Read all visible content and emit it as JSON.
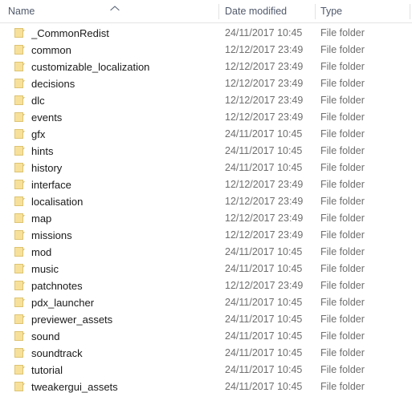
{
  "window": {
    "title": "File Explorer details list"
  },
  "header": {
    "columns": [
      {
        "id": "name",
        "label": "Name"
      },
      {
        "id": "date_modified",
        "label": "Date modified"
      },
      {
        "id": "type",
        "label": "Type"
      }
    ],
    "sort": {
      "column": "Name",
      "direction": "ascending",
      "icon": "chevron-up-icon"
    }
  },
  "list": {
    "icon": "folder-icon",
    "icon_color": "#f7e19a",
    "icon_border_color": "#ddc372",
    "rows": [
      {
        "name": "_CommonRedist",
        "date_modified": "24/11/2017 10:45",
        "type": "File folder"
      },
      {
        "name": "common",
        "date_modified": "12/12/2017 23:49",
        "type": "File folder"
      },
      {
        "name": "customizable_localization",
        "date_modified": "12/12/2017 23:49",
        "type": "File folder"
      },
      {
        "name": "decisions",
        "date_modified": "12/12/2017 23:49",
        "type": "File folder"
      },
      {
        "name": "dlc",
        "date_modified": "12/12/2017 23:49",
        "type": "File folder"
      },
      {
        "name": "events",
        "date_modified": "12/12/2017 23:49",
        "type": "File folder"
      },
      {
        "name": "gfx",
        "date_modified": "24/11/2017 10:45",
        "type": "File folder"
      },
      {
        "name": "hints",
        "date_modified": "24/11/2017 10:45",
        "type": "File folder"
      },
      {
        "name": "history",
        "date_modified": "24/11/2017 10:45",
        "type": "File folder"
      },
      {
        "name": "interface",
        "date_modified": "12/12/2017 23:49",
        "type": "File folder"
      },
      {
        "name": "localisation",
        "date_modified": "12/12/2017 23:49",
        "type": "File folder"
      },
      {
        "name": "map",
        "date_modified": "12/12/2017 23:49",
        "type": "File folder"
      },
      {
        "name": "missions",
        "date_modified": "12/12/2017 23:49",
        "type": "File folder"
      },
      {
        "name": "mod",
        "date_modified": "24/11/2017 10:45",
        "type": "File folder"
      },
      {
        "name": "music",
        "date_modified": "24/11/2017 10:45",
        "type": "File folder"
      },
      {
        "name": "patchnotes",
        "date_modified": "12/12/2017 23:49",
        "type": "File folder"
      },
      {
        "name": "pdx_launcher",
        "date_modified": "24/11/2017 10:45",
        "type": "File folder"
      },
      {
        "name": "previewer_assets",
        "date_modified": "24/11/2017 10:45",
        "type": "File folder"
      },
      {
        "name": "sound",
        "date_modified": "24/11/2017 10:45",
        "type": "File folder"
      },
      {
        "name": "soundtrack",
        "date_modified": "24/11/2017 10:45",
        "type": "File folder"
      },
      {
        "name": "tutorial",
        "date_modified": "24/11/2017 10:45",
        "type": "File folder"
      },
      {
        "name": "tweakergui_assets",
        "date_modified": "24/11/2017 10:45",
        "type": "File folder"
      }
    ]
  }
}
